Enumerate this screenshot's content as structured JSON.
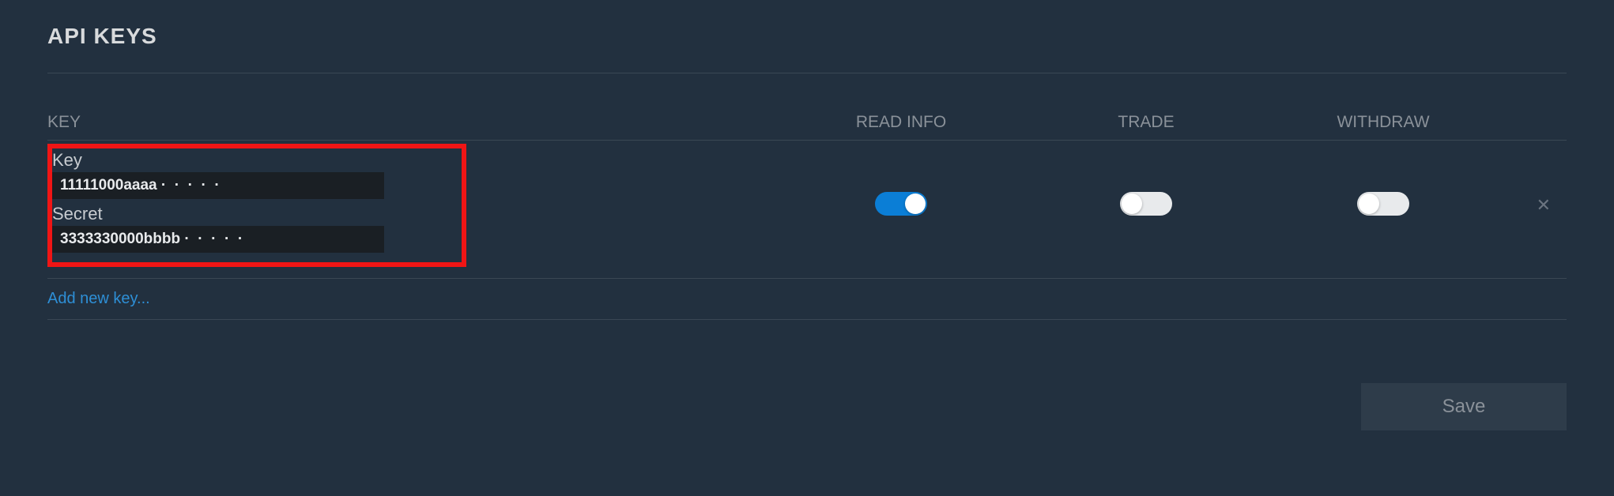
{
  "page": {
    "title": "API KEYS"
  },
  "columns": {
    "key": "KEY",
    "read": "READ INFO",
    "trade": "TRADE",
    "withdraw": "WITHDRAW"
  },
  "row": {
    "key_label": "Key",
    "key_value": "11111000aaaa ·  ·  ·  ·  ·",
    "secret_label": "Secret",
    "secret_value": "3333330000bbbb ·  ·  ·  ·  ·",
    "read_info": true,
    "trade": false,
    "withdraw": false
  },
  "actions": {
    "add_new": "Add new key...",
    "save": "Save"
  }
}
